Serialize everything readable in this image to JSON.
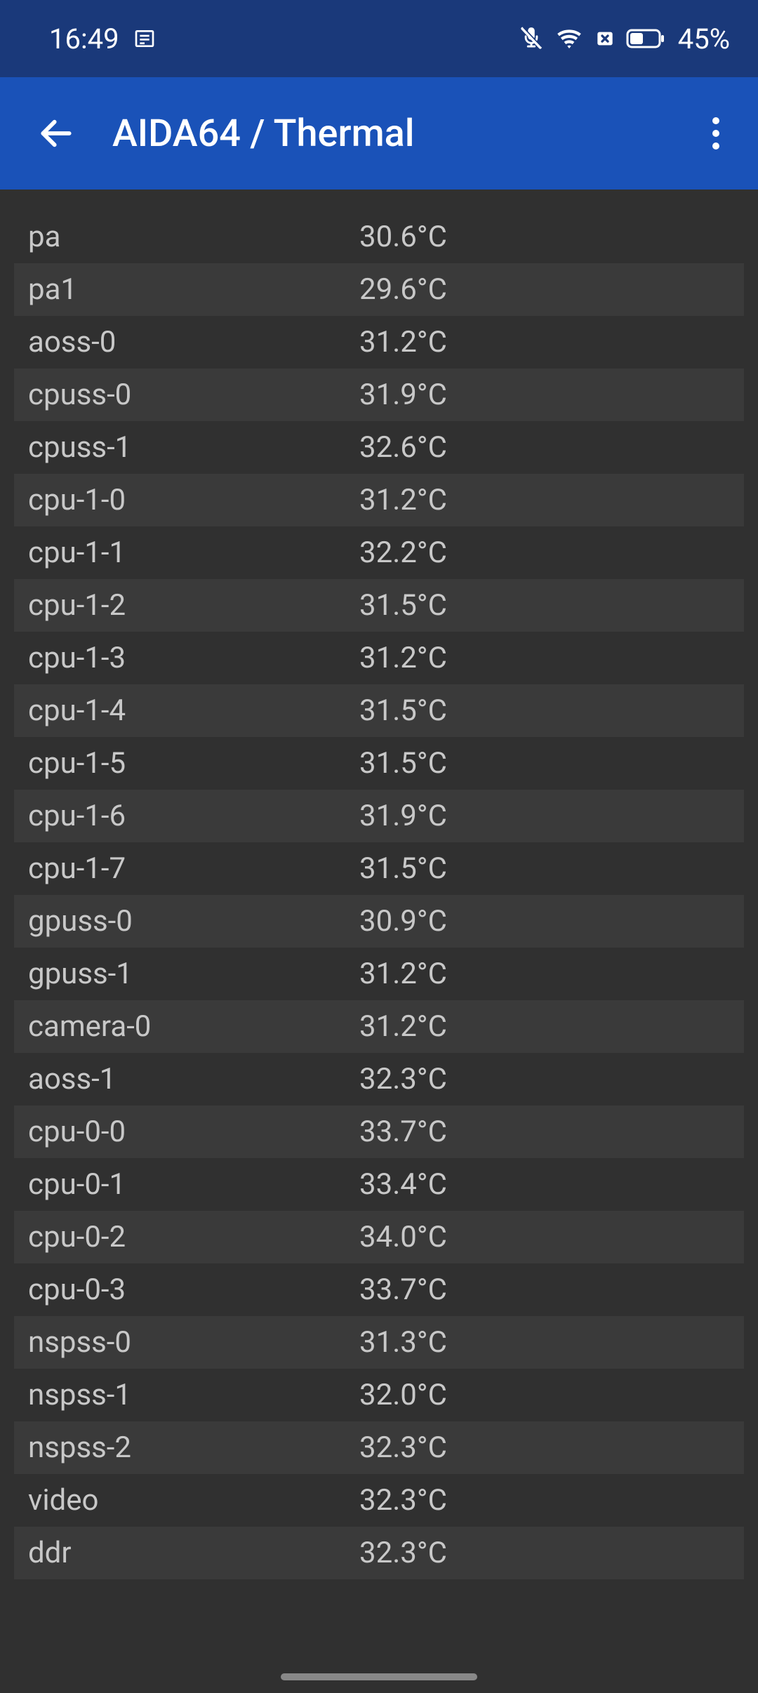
{
  "status_bar": {
    "time": "16:49",
    "battery": "45%"
  },
  "app_bar": {
    "title": "AIDA64  /  Thermal"
  },
  "sensors": [
    {
      "label": "pa",
      "value": "30.6°C"
    },
    {
      "label": "pa1",
      "value": "29.6°C"
    },
    {
      "label": "aoss-0",
      "value": "31.2°C"
    },
    {
      "label": "cpuss-0",
      "value": "31.9°C"
    },
    {
      "label": "cpuss-1",
      "value": "32.6°C"
    },
    {
      "label": "cpu-1-0",
      "value": "31.2°C"
    },
    {
      "label": "cpu-1-1",
      "value": "32.2°C"
    },
    {
      "label": "cpu-1-2",
      "value": "31.5°C"
    },
    {
      "label": "cpu-1-3",
      "value": "31.2°C"
    },
    {
      "label": "cpu-1-4",
      "value": "31.5°C"
    },
    {
      "label": "cpu-1-5",
      "value": "31.5°C"
    },
    {
      "label": "cpu-1-6",
      "value": "31.9°C"
    },
    {
      "label": "cpu-1-7",
      "value": "31.5°C"
    },
    {
      "label": "gpuss-0",
      "value": "30.9°C"
    },
    {
      "label": "gpuss-1",
      "value": "31.2°C"
    },
    {
      "label": "camera-0",
      "value": "31.2°C"
    },
    {
      "label": "aoss-1",
      "value": "32.3°C"
    },
    {
      "label": "cpu-0-0",
      "value": "33.7°C"
    },
    {
      "label": "cpu-0-1",
      "value": "33.4°C"
    },
    {
      "label": "cpu-0-2",
      "value": "34.0°C"
    },
    {
      "label": "cpu-0-3",
      "value": "33.7°C"
    },
    {
      "label": "nspss-0",
      "value": "31.3°C"
    },
    {
      "label": "nspss-1",
      "value": "32.0°C"
    },
    {
      "label": "nspss-2",
      "value": "32.3°C"
    },
    {
      "label": "video",
      "value": "32.3°C"
    },
    {
      "label": "ddr",
      "value": "32.3°C"
    }
  ]
}
